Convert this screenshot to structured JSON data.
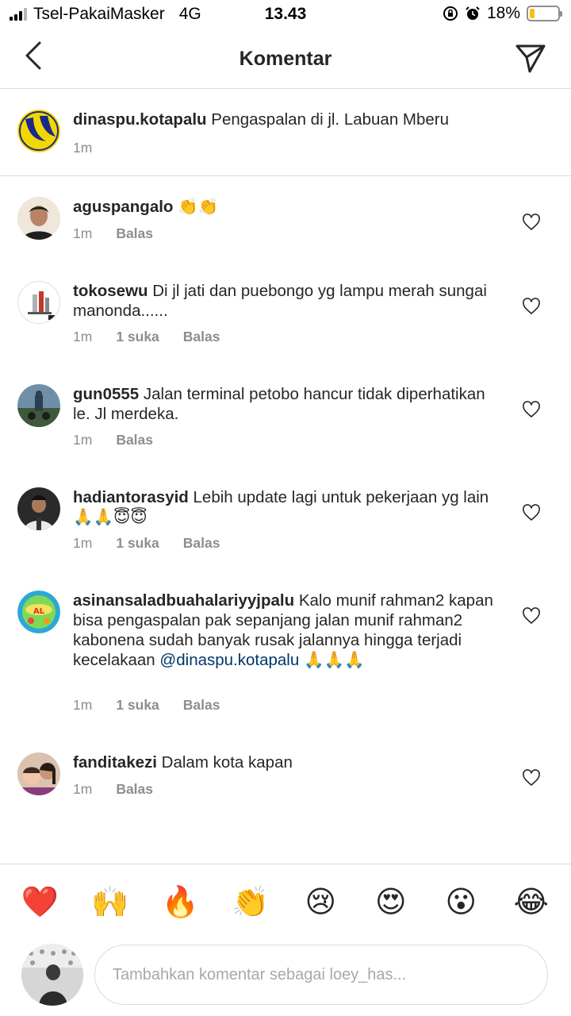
{
  "status_bar": {
    "carrier": "Tsel-PakaiMasker",
    "network": "4G",
    "time": "13.43",
    "battery": "18%",
    "battery_level": 0.18
  },
  "header": {
    "title": "Komentar",
    "back_icon": "chevron-left-icon",
    "send_icon": "paper-plane-icon"
  },
  "caption": {
    "username": "dinaspu.kotapalu",
    "text": "Pengaspalan di jl. Labuan Mberu",
    "time": "1m"
  },
  "comments": [
    {
      "username": "aguspangalo",
      "text": "👏👏",
      "time": "1m",
      "likes": "",
      "reply": "Balas"
    },
    {
      "username": "tokosewu",
      "text": "Di jl jati dan puebongo yg lampu merah sungai manonda......",
      "time": "1m",
      "likes": "1 suka",
      "reply": "Balas"
    },
    {
      "username": "gun0555",
      "text": "Jalan  terminal  petobo  hancur tidak diperhatikan le.  Jl merdeka.",
      "time": "1m",
      "likes": "",
      "reply": "Balas"
    },
    {
      "username": "hadiantorasyid",
      "text": "Lebih update lagi untuk pekerjaan yg lain 🙏🙏😇😇",
      "time": "1m",
      "likes": "1 suka",
      "reply": "Balas"
    },
    {
      "username": "asinansaladbuahalariyyjpalu",
      "text": "Kalo munif rahman2 kapan bisa pengaspalan pak sepanjang jalan munif rahman2 kabonena sudah banyak rusak jalannya hingga terjadi kecelakaan",
      "mention": "@dinaspu.kotapalu",
      "text_after": "🙏🙏🙏",
      "time": "1m",
      "likes": "1 suka",
      "reply": "Balas"
    },
    {
      "username": "fanditakezi",
      "text": "Dalam kota kapan",
      "time": "1m",
      "likes": "",
      "reply": "Balas"
    }
  ],
  "emoji_bar": [
    "❤️",
    "🙌",
    "🔥",
    "👏",
    "😢",
    "😍",
    "😮",
    "😂"
  ],
  "composer": {
    "placeholder": "Tambahkan komentar sebagai loey_has..."
  },
  "colors": {
    "text": "#262626",
    "secondary": "#8e8e8e",
    "mention": "#00376b",
    "divider": "#dbdbdb",
    "battery": "#f4c20d"
  }
}
